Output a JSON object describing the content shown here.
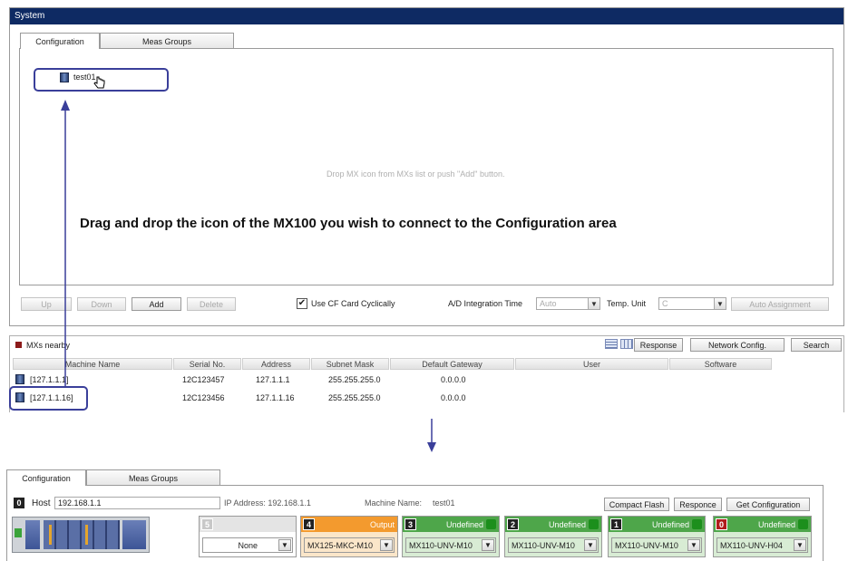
{
  "system_window": {
    "title": "System",
    "tabs": [
      "Configuration",
      "Meas Groups"
    ],
    "config_item": "test01",
    "drop_hint": "Drop MX icon from MXs list or push \"Add\" button.",
    "toolbar": {
      "up": "Up",
      "down": "Down",
      "add": "Add",
      "delete": "Delete",
      "use_cf": "Use CF Card Cyclically",
      "ad_label": "A/D Integration Time",
      "ad_value": "Auto",
      "temp_label": "Temp. Unit",
      "temp_value": "C",
      "auto_assign": "Auto Assignment"
    }
  },
  "annotation": "Drag and drop the icon of the MX100 you wish to connect to the Configuration area",
  "mxs_panel": {
    "title": "MXs nearby",
    "buttons": {
      "response": "Response",
      "network": "Network Config.",
      "search": "Search"
    },
    "columns": [
      "Machine Name",
      "Serial No.",
      "Address",
      "Subnet Mask",
      "Default Gateway",
      "User",
      "Software"
    ],
    "rows": [
      {
        "name": "[127.1.1.1]",
        "serial": "12C123457",
        "address": "127.1.1.1",
        "subnet": "255.255.255.0",
        "gateway": "0.0.0.0"
      },
      {
        "name": "[127.1.1.16]",
        "serial": "12C123456",
        "address": "127.1.1.16",
        "subnet": "255.255.255.0",
        "gateway": "0.0.0.0"
      }
    ]
  },
  "bottom_panel": {
    "tabs": [
      "Configuration",
      "Meas Groups"
    ],
    "host_label": "Host",
    "host_value": "192.168.1.1",
    "ip_text": "IP Address: 192.168.1.1",
    "machine_label": "Machine Name:",
    "machine_value": "test01",
    "buttons": {
      "cf": "Compact Flash",
      "resp": "Responce",
      "getconf": "Get Configuration"
    },
    "host_num": "0",
    "slots": [
      {
        "num": "5",
        "label": "",
        "module": "None",
        "color": "#e4e4e4"
      },
      {
        "num": "4",
        "label": "Output",
        "module": "MX125-MKC-M10",
        "color": "#f39a2e"
      },
      {
        "num": "3",
        "label": "Undefined",
        "module": "MX110-UNV-M10",
        "color": "#4ea64a"
      },
      {
        "num": "2",
        "label": "Undefined",
        "module": "MX110-UNV-M10",
        "color": "#4ea64a"
      },
      {
        "num": "1",
        "label": "Undefined",
        "module": "MX110-UNV-M10",
        "color": "#4ea64a"
      },
      {
        "num": "0",
        "label": "Undefined",
        "module": "MX110-UNV-H04",
        "color": "#4ea64a"
      }
    ]
  },
  "colors": {
    "titlebar": "#0e2a63",
    "annotation_arrow": "#3a3f9a",
    "mx_marker": "#8c1a1a"
  }
}
